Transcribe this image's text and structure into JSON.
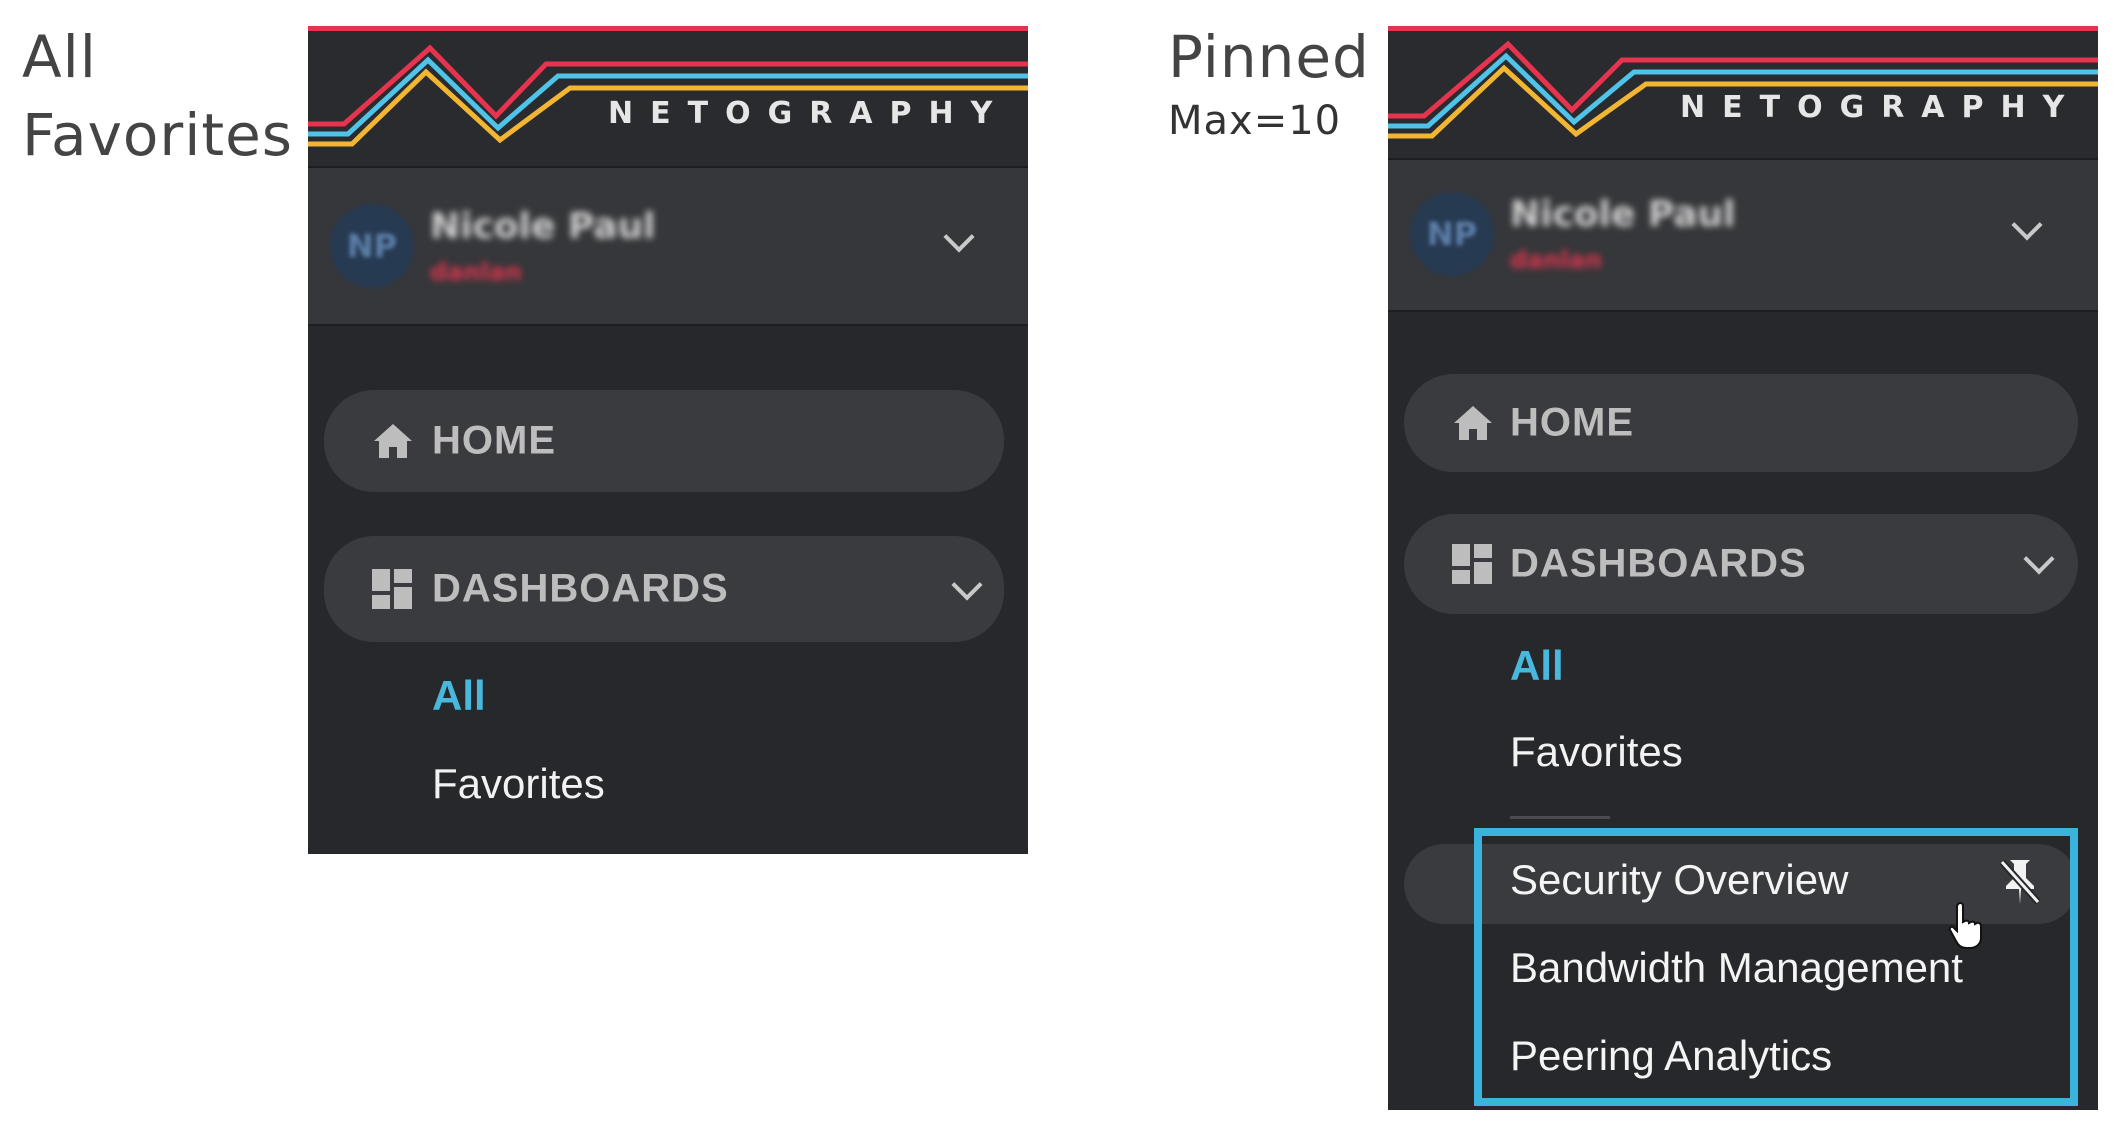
{
  "left_caption": {
    "line1": "All",
    "line2": "Favorites"
  },
  "right_caption": {
    "title": "Pinned",
    "subtitle": "Max=10"
  },
  "brand": {
    "name": "NETOGRAPHY",
    "colors": {
      "red": "#e8334f",
      "yellow": "#f2b632",
      "cyan": "#4fc3e8"
    }
  },
  "user": {
    "initials": "NP",
    "name": "Nicole Paul",
    "role": "danlan"
  },
  "nav": {
    "home_label": "HOME",
    "dashboards_label": "DASHBOARDS",
    "sub_all": "All",
    "sub_favorites": "Favorites"
  },
  "pinned": {
    "items": [
      "Security Overview",
      "Bandwidth Management",
      "Peering Analytics"
    ],
    "accent": "#3ab4dc"
  }
}
